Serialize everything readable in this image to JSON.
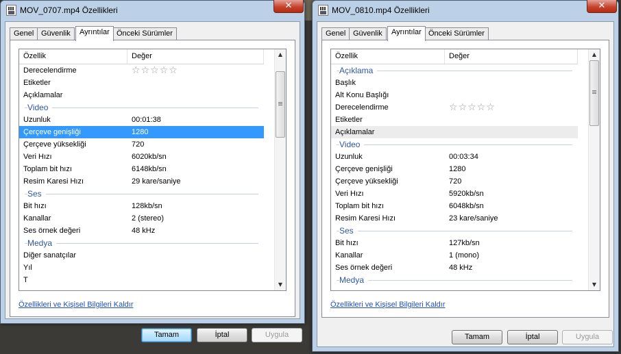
{
  "colors": {
    "accent_text": "#2f56a3",
    "selection": "#3399ff",
    "link": "#1f4fbf",
    "window_bg": "#f0f0f0"
  },
  "dialogs": [
    {
      "title": "MOV_0707.mp4 Özellikleri",
      "tabs": [
        "Genel",
        "Güvenlik",
        "Ayrıntılar",
        "Önceki Sürümler"
      ],
      "active_tab": "Ayrıntılar",
      "col_property": "Özellik",
      "col_value": "Değer",
      "rows": [
        {
          "type": "row",
          "label": "Derecelendirme",
          "value": "",
          "rating": 0
        },
        {
          "type": "row",
          "label": "Etiketler",
          "value": ""
        },
        {
          "type": "row",
          "label": "Açıklamalar",
          "value": ""
        },
        {
          "type": "section",
          "label": "Video"
        },
        {
          "type": "row",
          "label": "Uzunluk",
          "value": "00:01:38"
        },
        {
          "type": "row",
          "label": "Çerçeve genişliği",
          "value": "1280",
          "selected": true
        },
        {
          "type": "row",
          "label": "Çerçeve yüksekliği",
          "value": "720"
        },
        {
          "type": "row",
          "label": "Veri Hızı",
          "value": "6020kb/sn"
        },
        {
          "type": "row",
          "label": "Toplam bit hızı",
          "value": "6148kb/sn"
        },
        {
          "type": "row",
          "label": "Resim Karesi Hızı",
          "value": "29 kare/saniye"
        },
        {
          "type": "section",
          "label": "Ses"
        },
        {
          "type": "row",
          "label": "Bit hızı",
          "value": "128kb/sn"
        },
        {
          "type": "row",
          "label": "Kanallar",
          "value": "2 (stereo)"
        },
        {
          "type": "row",
          "label": "Ses örnek değeri",
          "value": "48 kHz"
        },
        {
          "type": "section",
          "label": "Medya"
        },
        {
          "type": "row",
          "label": "Diğer sanatçılar",
          "value": ""
        },
        {
          "type": "row",
          "label": "Yıl",
          "value": ""
        },
        {
          "type": "row",
          "label": "T",
          "value": ""
        }
      ],
      "link": "Özellikleri ve Kişisel Bilgileri Kaldır",
      "buttons": {
        "ok": "Tamam",
        "cancel": "İptal",
        "apply": "Uygula"
      }
    },
    {
      "title": "MOV_0810.mp4 Özellikleri",
      "tabs": [
        "Genel",
        "Güvenlik",
        "Ayrıntılar",
        "Önceki Sürümler"
      ],
      "active_tab": "Ayrıntılar",
      "col_property": "Özellik",
      "col_value": "Değer",
      "rows": [
        {
          "type": "section",
          "label": "Açıklama"
        },
        {
          "type": "row",
          "label": "Başlık",
          "value": ""
        },
        {
          "type": "row",
          "label": "Alt Konu Başlığı",
          "value": ""
        },
        {
          "type": "row",
          "label": "Derecelendirme",
          "value": "",
          "rating": 0
        },
        {
          "type": "row",
          "label": "Etiketler",
          "value": ""
        },
        {
          "type": "row",
          "label": "Açıklamalar",
          "value": "",
          "hover": true
        },
        {
          "type": "section",
          "label": "Video"
        },
        {
          "type": "row",
          "label": "Uzunluk",
          "value": "00:03:34"
        },
        {
          "type": "row",
          "label": "Çerçeve genişliği",
          "value": "1280"
        },
        {
          "type": "row",
          "label": "Çerçeve yüksekliği",
          "value": "720"
        },
        {
          "type": "row",
          "label": "Veri Hızı",
          "value": "5920kb/sn"
        },
        {
          "type": "row",
          "label": "Toplam bit hızı",
          "value": "6048kb/sn"
        },
        {
          "type": "row",
          "label": "Resim Karesi Hızı",
          "value": "23 kare/saniye"
        },
        {
          "type": "section",
          "label": "Ses"
        },
        {
          "type": "row",
          "label": "Bit hızı",
          "value": "127kb/sn"
        },
        {
          "type": "row",
          "label": "Kanallar",
          "value": "1 (mono)"
        },
        {
          "type": "row",
          "label": "Ses örnek değeri",
          "value": "48 kHz"
        },
        {
          "type": "section",
          "label": "Medya"
        }
      ],
      "link": "Özellikleri ve Kişisel Bilgileri Kaldır",
      "buttons": {
        "ok": "Tamam",
        "cancel": "İptal",
        "apply": "Uygula"
      }
    }
  ]
}
